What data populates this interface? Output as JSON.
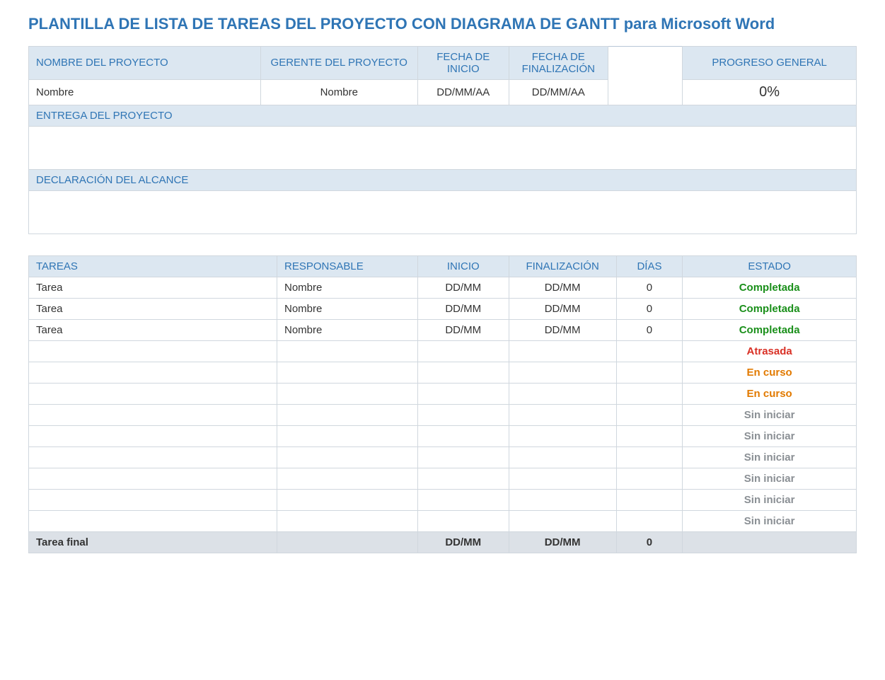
{
  "title": "PLANTILLA DE LISTA DE TAREAS DEL PROYECTO CON DIAGRAMA DE GANTT para Microsoft Word",
  "info_headers": {
    "project_name": "NOMBRE DEL PROYECTO",
    "project_manager": "GERENTE DEL PROYECTO",
    "start_date": "FECHA DE INICIO",
    "end_date": "FECHA DE FINALIZACIÓN",
    "overall_progress": "PROGRESO GENERAL"
  },
  "info_values": {
    "project_name": "Nombre",
    "project_manager": "Nombre",
    "start_date": "DD/MM/AA",
    "end_date": "DD/MM/AA",
    "overall_progress": "0%"
  },
  "sections": {
    "delivery": "ENTREGA DEL PROYECTO",
    "scope": "DECLARACIÓN DEL ALCANCE"
  },
  "task_headers": {
    "tasks": "TAREAS",
    "responsible": "RESPONSABLE",
    "start": "INICIO",
    "end": "FINALIZACIÓN",
    "days": "DÍAS",
    "status": "ESTADO"
  },
  "tasks": [
    {
      "task": "Tarea",
      "resp": "Nombre",
      "start": "DD/MM",
      "end": "DD/MM",
      "days": "0",
      "status": "Completada",
      "status_class": "status-completada"
    },
    {
      "task": "Tarea",
      "resp": "Nombre",
      "start": "DD/MM",
      "end": "DD/MM",
      "days": "0",
      "status": "Completada",
      "status_class": "status-completada"
    },
    {
      "task": "Tarea",
      "resp": "Nombre",
      "start": "DD/MM",
      "end": "DD/MM",
      "days": "0",
      "status": "Completada",
      "status_class": "status-completada"
    },
    {
      "task": "",
      "resp": "",
      "start": "",
      "end": "",
      "days": "",
      "status": "Atrasada",
      "status_class": "status-atrasada"
    },
    {
      "task": "",
      "resp": "",
      "start": "",
      "end": "",
      "days": "",
      "status": "En curso",
      "status_class": "status-encurso"
    },
    {
      "task": "",
      "resp": "",
      "start": "",
      "end": "",
      "days": "",
      "status": "En curso",
      "status_class": "status-encurso"
    },
    {
      "task": "",
      "resp": "",
      "start": "",
      "end": "",
      "days": "",
      "status": "Sin iniciar",
      "status_class": "status-siniciar"
    },
    {
      "task": "",
      "resp": "",
      "start": "",
      "end": "",
      "days": "",
      "status": "Sin iniciar",
      "status_class": "status-siniciar"
    },
    {
      "task": "",
      "resp": "",
      "start": "",
      "end": "",
      "days": "",
      "status": "Sin iniciar",
      "status_class": "status-siniciar"
    },
    {
      "task": "",
      "resp": "",
      "start": "",
      "end": "",
      "days": "",
      "status": "Sin iniciar",
      "status_class": "status-siniciar"
    },
    {
      "task": "",
      "resp": "",
      "start": "",
      "end": "",
      "days": "",
      "status": "Sin iniciar",
      "status_class": "status-siniciar"
    },
    {
      "task": "",
      "resp": "",
      "start": "",
      "end": "",
      "days": "",
      "status": "Sin iniciar",
      "status_class": "status-siniciar"
    }
  ],
  "final_row": {
    "label": "Tarea final",
    "start": "DD/MM",
    "end": "DD/MM",
    "days": "0"
  }
}
